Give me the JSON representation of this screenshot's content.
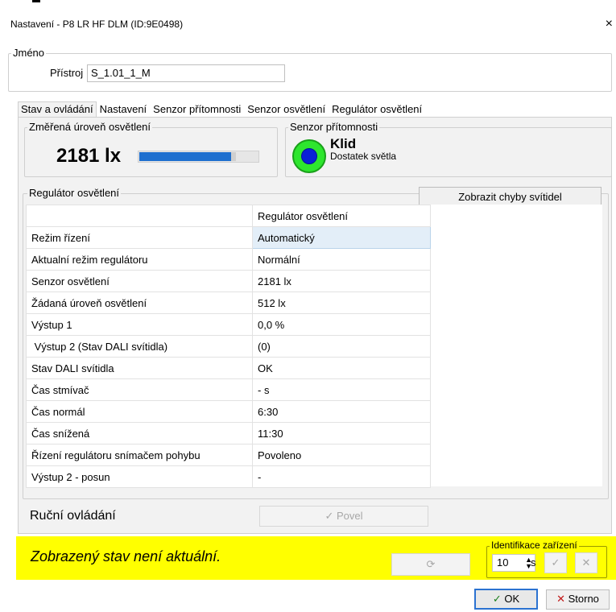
{
  "window": {
    "title": "Nastavení - P8 LR HF DLM (ID:9E0498)",
    "close_glyph": "×"
  },
  "name_group": {
    "label": "Jméno",
    "device_label": "Přístroj",
    "device_value": "S_1.01_1_M"
  },
  "tabs": [
    "Stav a ovládání",
    "Nastavení",
    "Senzor přítomnosti",
    "Senzor osvětlení",
    "Regulátor osvětlení"
  ],
  "measured": {
    "label": "Změřená úroveň osvětlení",
    "value": "2181 lx",
    "level_fraction": 0.78
  },
  "presence": {
    "label": "Senzor přítomnosti",
    "state": "Klid",
    "detail": "Dostatek světla",
    "colors": {
      "outer": "#2ee62e",
      "inner": "#0a1fd6"
    }
  },
  "regulator": {
    "group_label": "Regulátor osvětlení",
    "show_errors_label": "Zobrazit chyby svítidel",
    "column_header": "Regulátor osvětlení",
    "rows": [
      {
        "name": "Režim řízení",
        "value": "Automatický"
      },
      {
        "name": "Aktualní režim regulátoru",
        "value": "Normální"
      },
      {
        "name": "Senzor osvětlení",
        "value": "2181 lx"
      },
      {
        "name": "Žádaná úroveň osvětlení",
        "value": "512 lx"
      },
      {
        "name": "Výstup 1",
        "value": "0,0 %"
      },
      {
        "name": " Výstup 2 (Stav DALI svítidla)",
        "value": "(0)"
      },
      {
        "name": "Stav DALI svítidla",
        "value": "OK"
      },
      {
        "name": "Čas stmívač",
        "value": "- s"
      },
      {
        "name": "Čas normál",
        "value": "6:30"
      },
      {
        "name": "Čas snížená",
        "value": "11:30"
      },
      {
        "name": "Řízení regulátoru snímačem pohybu",
        "value": "Povoleno"
      },
      {
        "name": "Výstup 2 - posun",
        "value": "-"
      }
    ]
  },
  "manual": {
    "label": "Ruční ovládání",
    "command_label": "Povel",
    "command_icon": "check-icon"
  },
  "status_bar": {
    "warning": "Zobrazený stav není aktuální.",
    "color": "#ffff00",
    "refresh_icon": "refresh-icon"
  },
  "identification": {
    "label": "Identifikace zařízení",
    "value": "10",
    "unit": "s"
  },
  "footer": {
    "ok_label": "OK",
    "cancel_label": "Storno"
  }
}
